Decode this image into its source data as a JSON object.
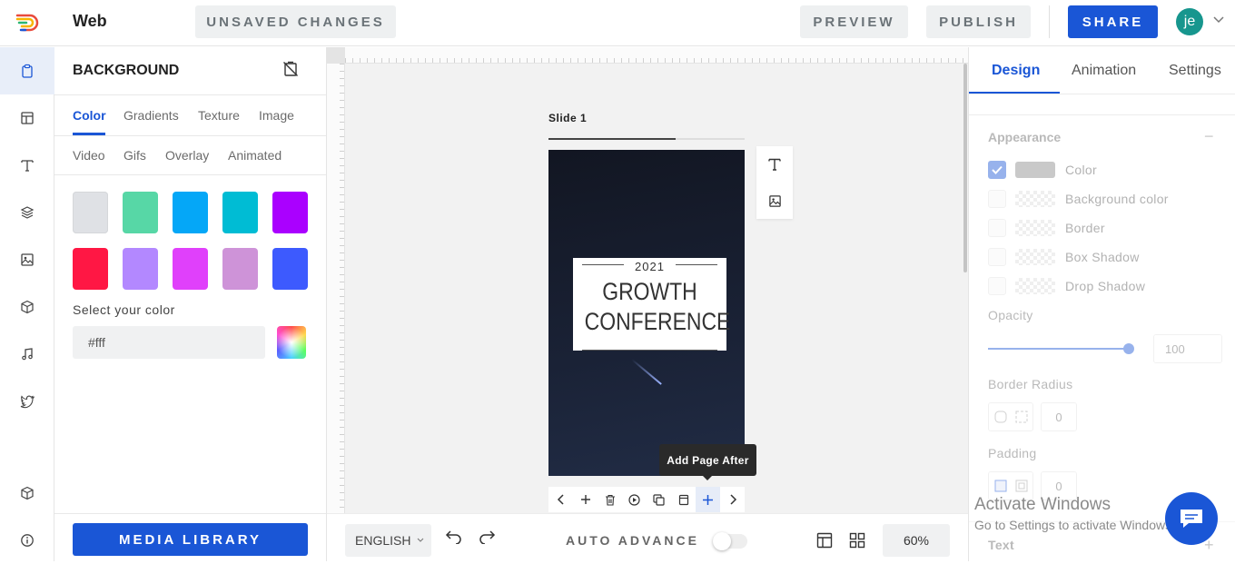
{
  "header": {
    "app_title": "Web",
    "status_label": "UNSAVED CHANGES",
    "preview_label": "PREVIEW",
    "publish_label": "PUBLISH",
    "share_label": "SHARE",
    "avatar_initials": "je"
  },
  "iconbar": {
    "items": [
      "clipboard-icon",
      "layout-icon",
      "text-icon",
      "layers-icon",
      "image-icon",
      "cube-icon",
      "music-icon",
      "twitter-icon",
      "box-icon",
      "info-icon"
    ]
  },
  "left_panel": {
    "title": "BACKGROUND",
    "tabs_row1": [
      "Color",
      "Gradients",
      "Texture",
      "Image"
    ],
    "tabs_row2": [
      "Video",
      "Gifs",
      "Overlay",
      "Animated"
    ],
    "active_tab": "Color",
    "swatches": [
      "#dfe1e5",
      "#57d7a6",
      "#05a7f7",
      "#00bcd4",
      "#aa00ff",
      "#ff1744",
      "#b388ff",
      "#e040fb",
      "#ce93d8",
      "#3d5afe"
    ],
    "select_label": "Select your color",
    "hex_value": "#fff",
    "media_library_label": "MEDIA LIBRARY"
  },
  "canvas": {
    "slide_label": "Slide 1",
    "year": "2021",
    "title_line1": "GROWTH",
    "title_line2": "CONFERENCE",
    "tooltip": "Add Page After"
  },
  "bottom_bar": {
    "language": "ENGLISH",
    "auto_advance_label": "AUTO ADVANCE",
    "auto_advance_on": false,
    "zoom": "60%"
  },
  "right_panel": {
    "tabs": [
      "Design",
      "Animation",
      "Settings"
    ],
    "active_tab": "Design",
    "appearance_label": "Appearance",
    "appearance_rows": [
      {
        "label": "Color",
        "checked": true
      },
      {
        "label": "Background color",
        "checked": false
      },
      {
        "label": "Border",
        "checked": false
      },
      {
        "label": "Box Shadow",
        "checked": false
      },
      {
        "label": "Drop Shadow",
        "checked": false
      }
    ],
    "opacity_label": "Opacity",
    "opacity_value": "100",
    "border_radius_label": "Border Radius",
    "border_radius_value": "0",
    "padding_label": "Padding",
    "padding_value": "0",
    "text_label": "Text"
  },
  "windows_notice": {
    "title": "Activate Windows",
    "subtitle": "Go to Settings to activate Windows."
  },
  "colors": {
    "accent": "#1a56d6",
    "avatar": "#17968e"
  }
}
